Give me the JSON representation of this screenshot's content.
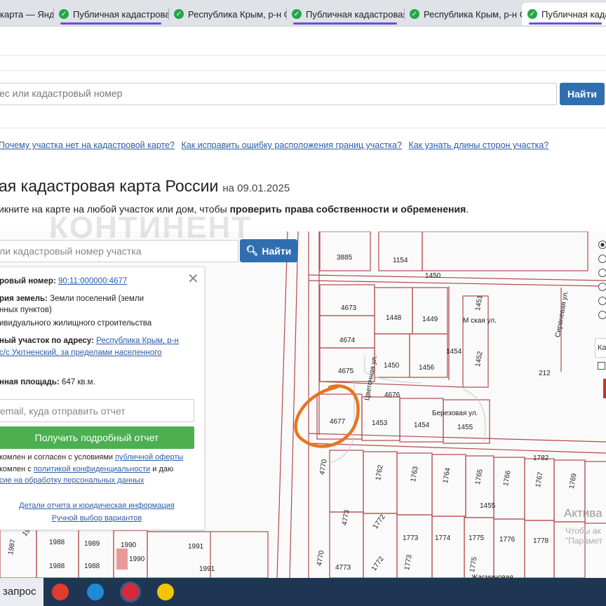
{
  "tabs": [
    {
      "label": "карта — Янд",
      "checked": false
    },
    {
      "label": "Публичная кадастровая",
      "checked": true
    },
    {
      "label": "Республика Крым, р-н Са",
      "checked": true
    },
    {
      "label": "Публичная кадастровая",
      "checked": true
    },
    {
      "label": "Республика Крым, р-н Са",
      "checked": true
    },
    {
      "label": "Публичная кадастровая",
      "checked": true
    }
  ],
  "search": {
    "placeholder": "ес или кадастровый номер",
    "button": "Найти"
  },
  "help_links": [
    "Почему участка нет на кадастровой карте?",
    "Как исправить ошибку расположения границ участка?",
    "Как узнать длины сторон участка?"
  ],
  "title": {
    "main": "ая кадастровая карта России",
    "date": "на 09.01.2025"
  },
  "subline": {
    "text": "икните на карте на любой участок или дом, чтобы ",
    "bold": "проверить права собственности и обременения",
    "end": "."
  },
  "map_search": {
    "placeholder": "ли кадастровый номер участка",
    "button": "Найти"
  },
  "panel": {
    "cad_label": "ровый номер:",
    "cad_value": "90:11:000000:4677",
    "category_label": "рия земель:",
    "category_value": "Земли поселений (земли",
    "category_line2": "нных пунктов)",
    "use_line": "ивидуального жилищного строительства",
    "address_label": "ный участок по адресу:",
    "address_value": "Республика Крым, р-н",
    "address_line2": "с/с Уютненский, за пределами населенного",
    "area_label": "нная площадь:",
    "area_value": "647 кв.м.",
    "email_placeholder": "email, куда отправить отчет",
    "report_button": "Получить подробный отчет",
    "agree1_a": "комлен и согласен с условиями ",
    "agree1_link": "публичной оферты",
    "agree2_a": "комлен с ",
    "agree2_link": "политикой конфиденциальности",
    "agree2_b": " и даю",
    "agree3_link": "сие на обработку персональных данных",
    "details_link": "Детали отчета и юридическая информация",
    "manual_link": "Ручной выбор вариантов"
  },
  "watermark": "КОНТИНЕНТ",
  "map_labels": {
    "parcels": [
      "3885",
      "1154",
      "1450",
      "4673",
      "1448",
      "1449",
      "1451",
      "4674",
      "1454",
      "4675",
      "1450",
      "1456",
      "1452",
      "212",
      "4676",
      "4677",
      "1453",
      "1454",
      "1455",
      "1782",
      "4770",
      "1762",
      "1763",
      "1764",
      "1765",
      "1766",
      "1767",
      "1769",
      "1455",
      "4773",
      "1772",
      "1773",
      "1774",
      "1775",
      "1776",
      "1778",
      "1987",
      "1988",
      "1989",
      "1990",
      "1991",
      "1991",
      "1988",
      "1988",
      "1990",
      "1987",
      "4770",
      "4773",
      "1772",
      "1773",
      "1775"
    ],
    "streets": [
      "Цветочная ул.",
      "Березовая ул.",
      "Сиреневая ул.",
      "М ская ул.",
      "Жасминовая"
    ]
  },
  "side": {
    "box_text": "Ка"
  },
  "activation": {
    "title": "Актива",
    "line1": "Чтобы ак",
    "line2": "\"Парамет"
  },
  "taskbar": {
    "search_label": "запрос"
  }
}
